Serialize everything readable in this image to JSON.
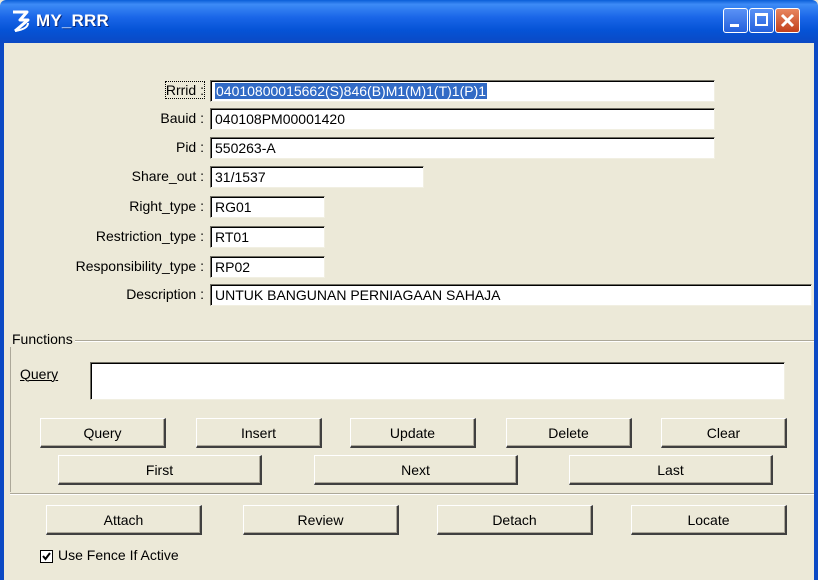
{
  "window": {
    "title": "MY_RRR"
  },
  "form": {
    "rrrid_label": "Rrrid :",
    "rrrid_value": "04010800015662(S)846(B)M1(M)1(T)1(P)1",
    "bauid_label": "Bauid :",
    "bauid_value": "040108PM00001420",
    "pid_label": "Pid :",
    "pid_value": "550263-A",
    "share_out_label": "Share_out :",
    "share_out_value": "31/1537",
    "right_type_label": "Right_type :",
    "right_type_value": "RG01",
    "restriction_type_label": "Restriction_type :",
    "restriction_type_value": "RT01",
    "responsibility_type_label": "Responsibility_type :",
    "responsibility_type_value": "RP02",
    "description_label": "Description :",
    "description_value": "UNTUK BANGUNAN PERNIAGAAN SAHAJA"
  },
  "functions": {
    "group_label": "Functions",
    "query_label": "Query",
    "query_value": ""
  },
  "buttons": {
    "query": "Query",
    "insert": "Insert",
    "update": "Update",
    "delete": "Delete",
    "clear": "Clear",
    "first": "First",
    "next": "Next",
    "last": "Last",
    "attach": "Attach",
    "review": "Review",
    "detach": "Detach",
    "locate": "Locate"
  },
  "fence": {
    "label": "Use Fence If Active",
    "checked": true
  }
}
